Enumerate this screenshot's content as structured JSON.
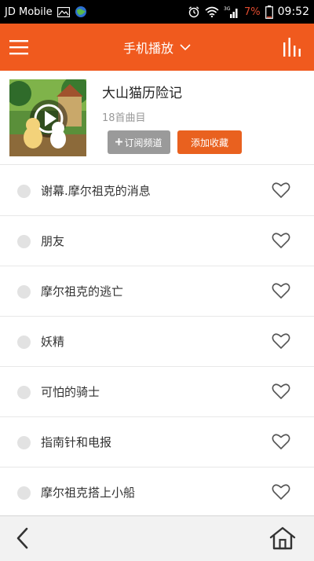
{
  "status_bar": {
    "carrier": "JD Mobile",
    "network": "3G",
    "battery_percent": "7%",
    "time": "09:52"
  },
  "header": {
    "title": "手机播放",
    "menu_icon": "hamburger-icon",
    "dropdown_icon": "chevron-down-icon",
    "right_icon": "equalizer-icon"
  },
  "album": {
    "title": "大山猫历险记",
    "track_count": "18首曲目",
    "subscribe_label": "订阅频道",
    "favorite_label": "添加收藏"
  },
  "tracks": [
    {
      "title": "谢幕.摩尔祖克的消息"
    },
    {
      "title": "朋友"
    },
    {
      "title": "摩尔祖克的逃亡"
    },
    {
      "title": "妖精"
    },
    {
      "title": "可怕的骑士"
    },
    {
      "title": "指南针和电报"
    },
    {
      "title": "摩尔祖克搭上小船"
    }
  ],
  "colors": {
    "brand": "#f05a1e",
    "subscribe_button": "#9a9a9a",
    "favorite_button": "#e9611f",
    "battery_low": "#e04b2f"
  },
  "bottom_nav": {
    "back_icon": "back-arrow-icon",
    "home_icon": "home-icon"
  }
}
